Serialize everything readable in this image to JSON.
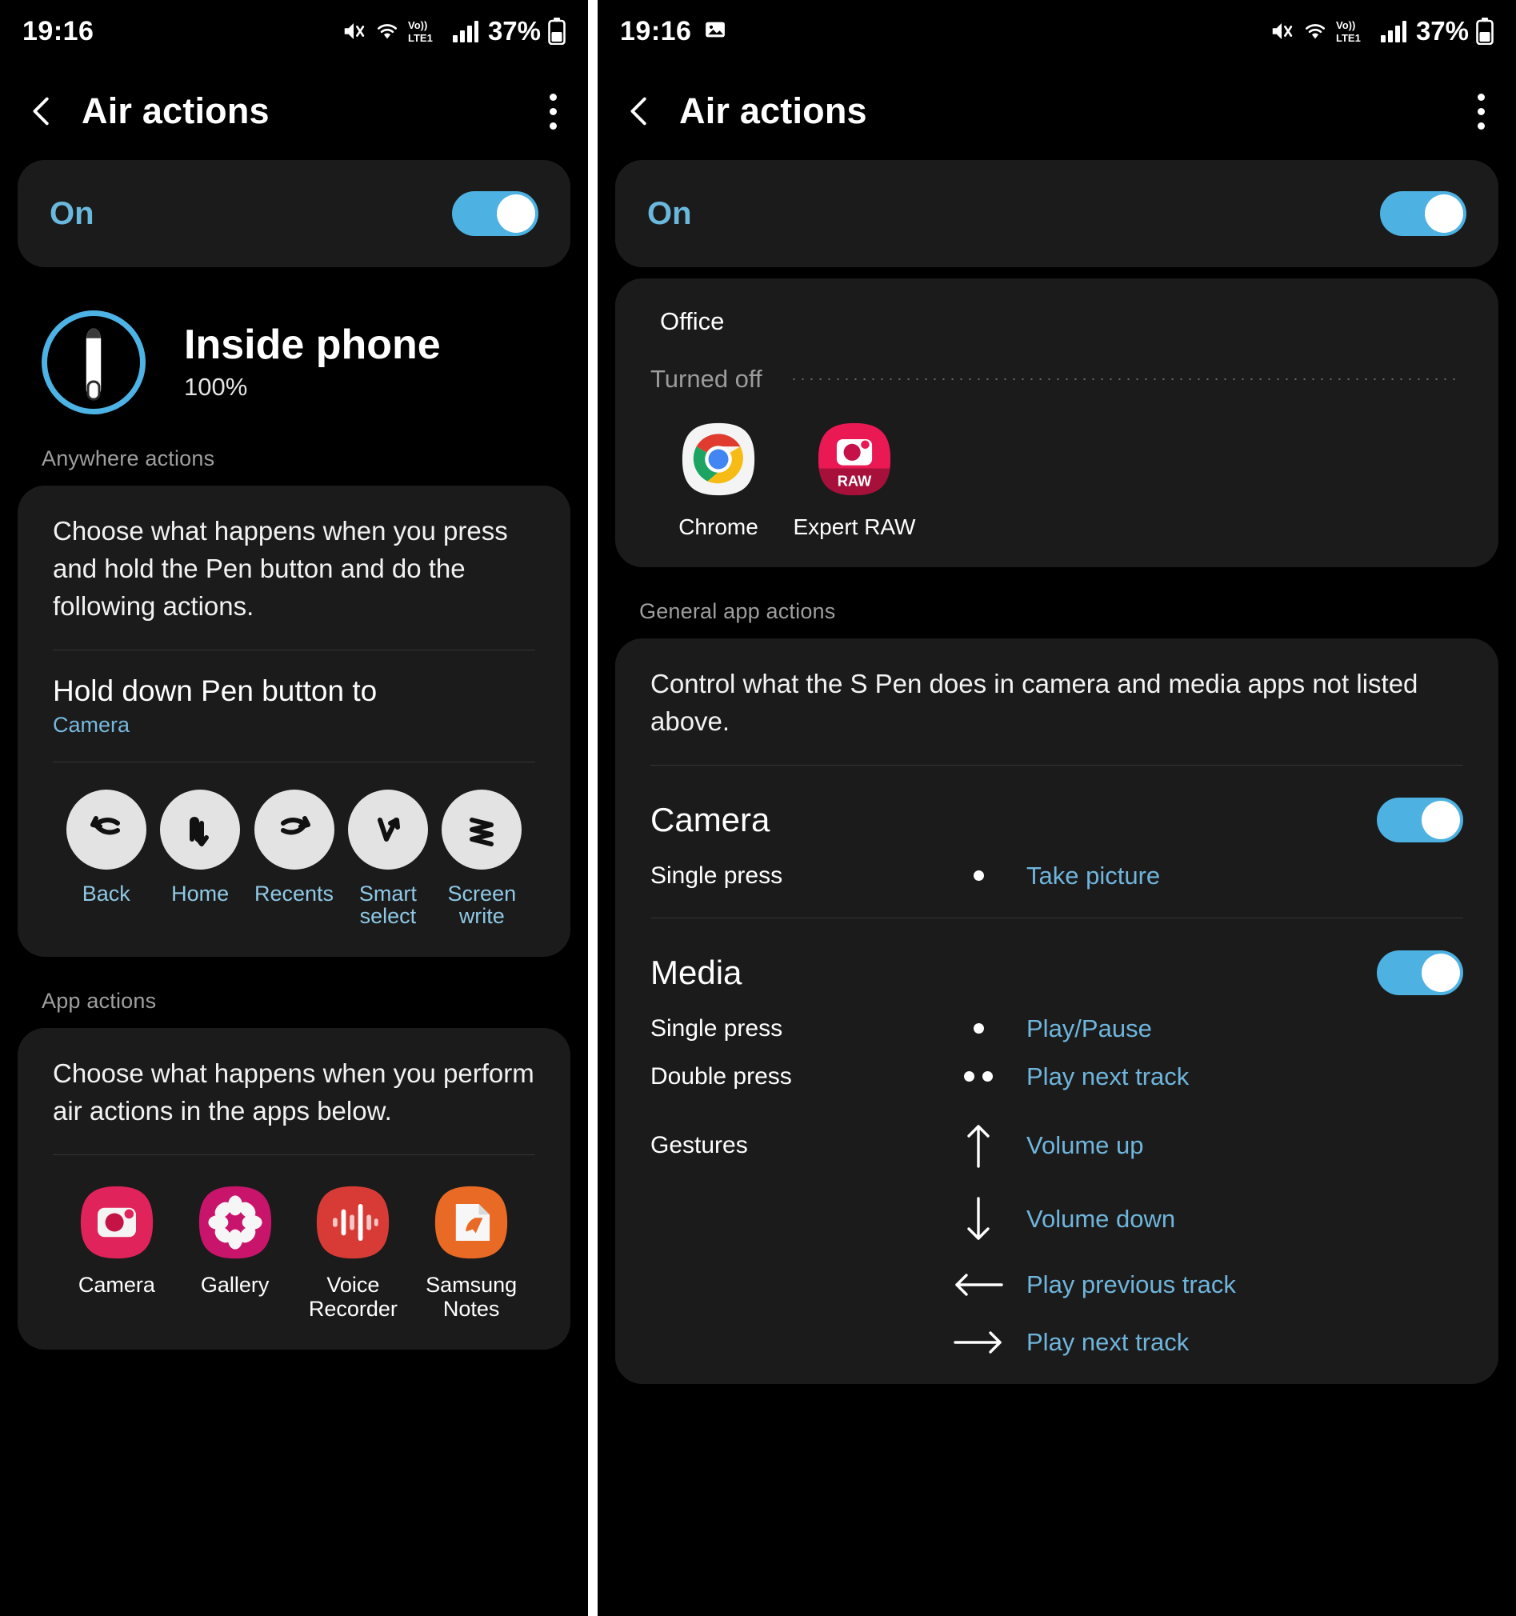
{
  "left": {
    "status": {
      "time": "19:16",
      "battery": "37%",
      "network": "LTE1",
      "icons": [
        "mute-icon",
        "wifi-icon",
        "volte-icon",
        "signal-icon",
        "battery-icon"
      ]
    },
    "appbar": {
      "title": "Air actions",
      "back_icon": "back-chevron-icon",
      "overflow_icon": "more-vertical-icon"
    },
    "master": {
      "label": "On",
      "toggle_state": "on"
    },
    "pen": {
      "title": "Inside phone",
      "battery": "100%",
      "icon": "s-pen-icon"
    },
    "anywhere": {
      "section_label": "Anywhere actions",
      "description": "Choose what happens when you press and hold the Pen button and do the following actions.",
      "setting_title": "Hold down Pen button to",
      "setting_value": "Camera",
      "gestures": [
        {
          "label": "Back",
          "icon": "gesture-back-icon"
        },
        {
          "label": "Home",
          "icon": "gesture-home-icon"
        },
        {
          "label": "Recents",
          "icon": "gesture-recents-icon"
        },
        {
          "label": "Smart select",
          "icon": "gesture-smart-select-icon"
        },
        {
          "label": "Screen write",
          "icon": "gesture-screen-write-icon"
        }
      ]
    },
    "appactions": {
      "section_label": "App actions",
      "description": "Choose what happens when you perform air actions in the apps below.",
      "apps": [
        {
          "name": "Camera",
          "icon": "camera-app-icon"
        },
        {
          "name": "Gallery",
          "icon": "gallery-app-icon"
        },
        {
          "name": "Voice Recorder",
          "icon": "voice-recorder-app-icon"
        },
        {
          "name": "Samsung Notes",
          "icon": "samsung-notes-app-icon"
        }
      ]
    }
  },
  "right": {
    "status": {
      "time": "19:16",
      "battery": "37%",
      "network": "LTE1",
      "icons": [
        "screenshot-icon",
        "mute-icon",
        "wifi-icon",
        "volte-icon",
        "signal-icon",
        "battery-icon"
      ]
    },
    "appbar": {
      "title": "Air actions",
      "back_icon": "back-chevron-icon",
      "overflow_icon": "more-vertical-icon"
    },
    "master": {
      "label": "On",
      "toggle_state": "on"
    },
    "group": {
      "name": "Office",
      "turned_off_label": "Turned off",
      "tiles": [
        {
          "name": "Chrome",
          "icon": "chrome-app-icon"
        },
        {
          "name": "Expert RAW",
          "icon": "expert-raw-app-icon",
          "badge": "RAW"
        }
      ]
    },
    "general": {
      "section_label": "General app actions",
      "description": "Control what the S Pen does in camera and media apps not listed above.",
      "items": [
        {
          "title": "Camera",
          "toggle_state": "on",
          "rows": [
            {
              "label": "Single press",
              "symbol": "single-dot",
              "value": "Take picture"
            }
          ]
        },
        {
          "title": "Media",
          "toggle_state": "on",
          "rows": [
            {
              "label": "Single press",
              "symbol": "single-dot",
              "value": "Play/Pause"
            },
            {
              "label": "Double press",
              "symbol": "double-dot",
              "value": "Play next track"
            },
            {
              "label": "Gestures",
              "symbol": "arrow-up",
              "value": "Volume up"
            },
            {
              "label": "",
              "symbol": "arrow-down",
              "value": "Volume down"
            },
            {
              "label": "",
              "symbol": "arrow-left",
              "value": "Play previous track"
            },
            {
              "label": "",
              "symbol": "arrow-right",
              "value": "Play next track"
            }
          ]
        }
      ]
    }
  },
  "colors": {
    "accent": "#4cb3e4",
    "link": "#6fb5dc",
    "card": "#1b1b1b",
    "background": "#000000"
  }
}
